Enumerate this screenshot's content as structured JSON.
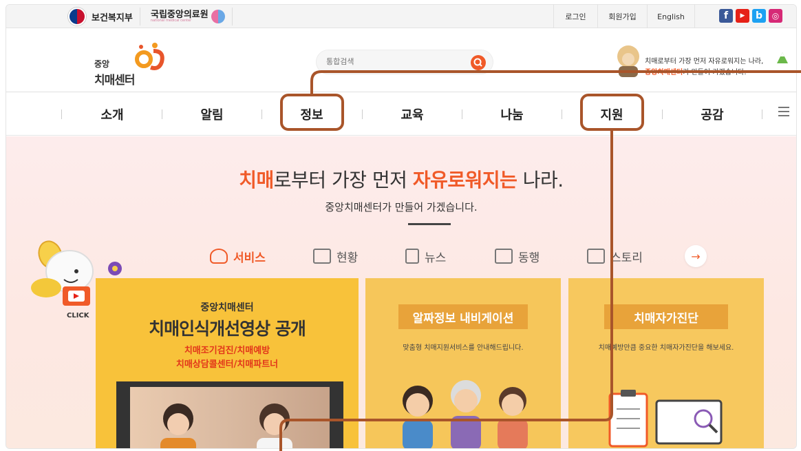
{
  "topbar": {
    "gov_name": "보건복지부",
    "nmc_name": "국립중앙의료원",
    "nmc_sub": "national medical center",
    "login": "로그인",
    "signup": "회원가입",
    "english": "English",
    "social": [
      {
        "icon": "facebook-icon",
        "glyph": "f",
        "color": "#3b5998"
      },
      {
        "icon": "youtube-icon",
        "glyph": "▶",
        "color": "#e62117"
      },
      {
        "icon": "blog-icon",
        "glyph": "b",
        "color": "#1da1f2"
      },
      {
        "icon": "instagram-icon",
        "glyph": "◎",
        "color": "#d62976"
      }
    ]
  },
  "header": {
    "logo_small": "중앙",
    "logo_big": "치매센터",
    "search_placeholder": "통합검색",
    "slogan_line1": "치매로부터 가장 먼저 자유로워지는 나라,",
    "slogan_line2_hl": "중앙치매센터",
    "slogan_line2_rest": "가 만들어 가겠습니다."
  },
  "nav": {
    "items": [
      "소개",
      "알림",
      "정보",
      "교육",
      "나눔",
      "지원",
      "공감"
    ]
  },
  "hero": {
    "title_acc1": "치매",
    "title_mid": "로부터 가장 먼저 ",
    "title_acc2": "자유로워지는",
    "title_end": " 나라.",
    "subtitle": "중앙치매센터가 만들어 가겠습니다.",
    "tabs": [
      "서비스",
      "현황",
      "뉴스",
      "동행",
      "스토리"
    ],
    "next": "→",
    "click_label": "CLICK"
  },
  "cards": {
    "c1_small": "중앙치매센터",
    "c1_big": "치매인식개선영상 공개",
    "c1_tags1": "치매조기검진/치매예방",
    "c1_tags2": "치매상담콜센터/치매파트너",
    "c2_title": "알짜정보 내비게이션",
    "c2_desc": "맞춤형 치매지원서비스를 안내해드립니다.",
    "c3_title": "치매자가진단",
    "c3_desc": "치매예방만큼 중요한 치매자가진단을 해보세요."
  },
  "colors": {
    "accent": "#f05a28",
    "highlight_box": "#a9552a"
  }
}
